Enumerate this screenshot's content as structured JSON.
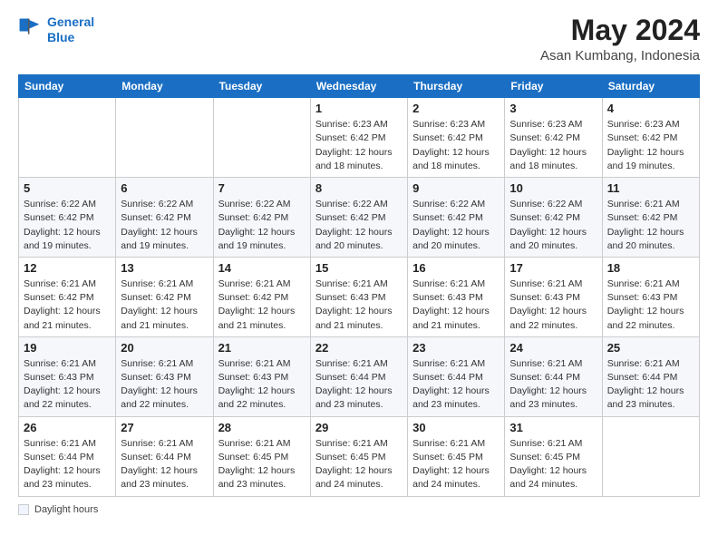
{
  "logo": {
    "line1": "General",
    "line2": "Blue"
  },
  "header": {
    "month": "May 2024",
    "location": "Asan Kumbang, Indonesia"
  },
  "weekdays": [
    "Sunday",
    "Monday",
    "Tuesday",
    "Wednesday",
    "Thursday",
    "Friday",
    "Saturday"
  ],
  "weeks": [
    [
      {
        "day": "",
        "sunrise": "",
        "sunset": "",
        "daylight": ""
      },
      {
        "day": "",
        "sunrise": "",
        "sunset": "",
        "daylight": ""
      },
      {
        "day": "",
        "sunrise": "",
        "sunset": "",
        "daylight": ""
      },
      {
        "day": "1",
        "sunrise": "Sunrise: 6:23 AM",
        "sunset": "Sunset: 6:42 PM",
        "daylight": "Daylight: 12 hours and 18 minutes."
      },
      {
        "day": "2",
        "sunrise": "Sunrise: 6:23 AM",
        "sunset": "Sunset: 6:42 PM",
        "daylight": "Daylight: 12 hours and 18 minutes."
      },
      {
        "day": "3",
        "sunrise": "Sunrise: 6:23 AM",
        "sunset": "Sunset: 6:42 PM",
        "daylight": "Daylight: 12 hours and 18 minutes."
      },
      {
        "day": "4",
        "sunrise": "Sunrise: 6:23 AM",
        "sunset": "Sunset: 6:42 PM",
        "daylight": "Daylight: 12 hours and 19 minutes."
      }
    ],
    [
      {
        "day": "5",
        "sunrise": "Sunrise: 6:22 AM",
        "sunset": "Sunset: 6:42 PM",
        "daylight": "Daylight: 12 hours and 19 minutes."
      },
      {
        "day": "6",
        "sunrise": "Sunrise: 6:22 AM",
        "sunset": "Sunset: 6:42 PM",
        "daylight": "Daylight: 12 hours and 19 minutes."
      },
      {
        "day": "7",
        "sunrise": "Sunrise: 6:22 AM",
        "sunset": "Sunset: 6:42 PM",
        "daylight": "Daylight: 12 hours and 19 minutes."
      },
      {
        "day": "8",
        "sunrise": "Sunrise: 6:22 AM",
        "sunset": "Sunset: 6:42 PM",
        "daylight": "Daylight: 12 hours and 20 minutes."
      },
      {
        "day": "9",
        "sunrise": "Sunrise: 6:22 AM",
        "sunset": "Sunset: 6:42 PM",
        "daylight": "Daylight: 12 hours and 20 minutes."
      },
      {
        "day": "10",
        "sunrise": "Sunrise: 6:22 AM",
        "sunset": "Sunset: 6:42 PM",
        "daylight": "Daylight: 12 hours and 20 minutes."
      },
      {
        "day": "11",
        "sunrise": "Sunrise: 6:21 AM",
        "sunset": "Sunset: 6:42 PM",
        "daylight": "Daylight: 12 hours and 20 minutes."
      }
    ],
    [
      {
        "day": "12",
        "sunrise": "Sunrise: 6:21 AM",
        "sunset": "Sunset: 6:42 PM",
        "daylight": "Daylight: 12 hours and 21 minutes."
      },
      {
        "day": "13",
        "sunrise": "Sunrise: 6:21 AM",
        "sunset": "Sunset: 6:42 PM",
        "daylight": "Daylight: 12 hours and 21 minutes."
      },
      {
        "day": "14",
        "sunrise": "Sunrise: 6:21 AM",
        "sunset": "Sunset: 6:42 PM",
        "daylight": "Daylight: 12 hours and 21 minutes."
      },
      {
        "day": "15",
        "sunrise": "Sunrise: 6:21 AM",
        "sunset": "Sunset: 6:43 PM",
        "daylight": "Daylight: 12 hours and 21 minutes."
      },
      {
        "day": "16",
        "sunrise": "Sunrise: 6:21 AM",
        "sunset": "Sunset: 6:43 PM",
        "daylight": "Daylight: 12 hours and 21 minutes."
      },
      {
        "day": "17",
        "sunrise": "Sunrise: 6:21 AM",
        "sunset": "Sunset: 6:43 PM",
        "daylight": "Daylight: 12 hours and 22 minutes."
      },
      {
        "day": "18",
        "sunrise": "Sunrise: 6:21 AM",
        "sunset": "Sunset: 6:43 PM",
        "daylight": "Daylight: 12 hours and 22 minutes."
      }
    ],
    [
      {
        "day": "19",
        "sunrise": "Sunrise: 6:21 AM",
        "sunset": "Sunset: 6:43 PM",
        "daylight": "Daylight: 12 hours and 22 minutes."
      },
      {
        "day": "20",
        "sunrise": "Sunrise: 6:21 AM",
        "sunset": "Sunset: 6:43 PM",
        "daylight": "Daylight: 12 hours and 22 minutes."
      },
      {
        "day": "21",
        "sunrise": "Sunrise: 6:21 AM",
        "sunset": "Sunset: 6:43 PM",
        "daylight": "Daylight: 12 hours and 22 minutes."
      },
      {
        "day": "22",
        "sunrise": "Sunrise: 6:21 AM",
        "sunset": "Sunset: 6:44 PM",
        "daylight": "Daylight: 12 hours and 23 minutes."
      },
      {
        "day": "23",
        "sunrise": "Sunrise: 6:21 AM",
        "sunset": "Sunset: 6:44 PM",
        "daylight": "Daylight: 12 hours and 23 minutes."
      },
      {
        "day": "24",
        "sunrise": "Sunrise: 6:21 AM",
        "sunset": "Sunset: 6:44 PM",
        "daylight": "Daylight: 12 hours and 23 minutes."
      },
      {
        "day": "25",
        "sunrise": "Sunrise: 6:21 AM",
        "sunset": "Sunset: 6:44 PM",
        "daylight": "Daylight: 12 hours and 23 minutes."
      }
    ],
    [
      {
        "day": "26",
        "sunrise": "Sunrise: 6:21 AM",
        "sunset": "Sunset: 6:44 PM",
        "daylight": "Daylight: 12 hours and 23 minutes."
      },
      {
        "day": "27",
        "sunrise": "Sunrise: 6:21 AM",
        "sunset": "Sunset: 6:44 PM",
        "daylight": "Daylight: 12 hours and 23 minutes."
      },
      {
        "day": "28",
        "sunrise": "Sunrise: 6:21 AM",
        "sunset": "Sunset: 6:45 PM",
        "daylight": "Daylight: 12 hours and 23 minutes."
      },
      {
        "day": "29",
        "sunrise": "Sunrise: 6:21 AM",
        "sunset": "Sunset: 6:45 PM",
        "daylight": "Daylight: 12 hours and 24 minutes."
      },
      {
        "day": "30",
        "sunrise": "Sunrise: 6:21 AM",
        "sunset": "Sunset: 6:45 PM",
        "daylight": "Daylight: 12 hours and 24 minutes."
      },
      {
        "day": "31",
        "sunrise": "Sunrise: 6:21 AM",
        "sunset": "Sunset: 6:45 PM",
        "daylight": "Daylight: 12 hours and 24 minutes."
      },
      {
        "day": "",
        "sunrise": "",
        "sunset": "",
        "daylight": ""
      }
    ]
  ],
  "footer": {
    "label": "Daylight hours"
  }
}
